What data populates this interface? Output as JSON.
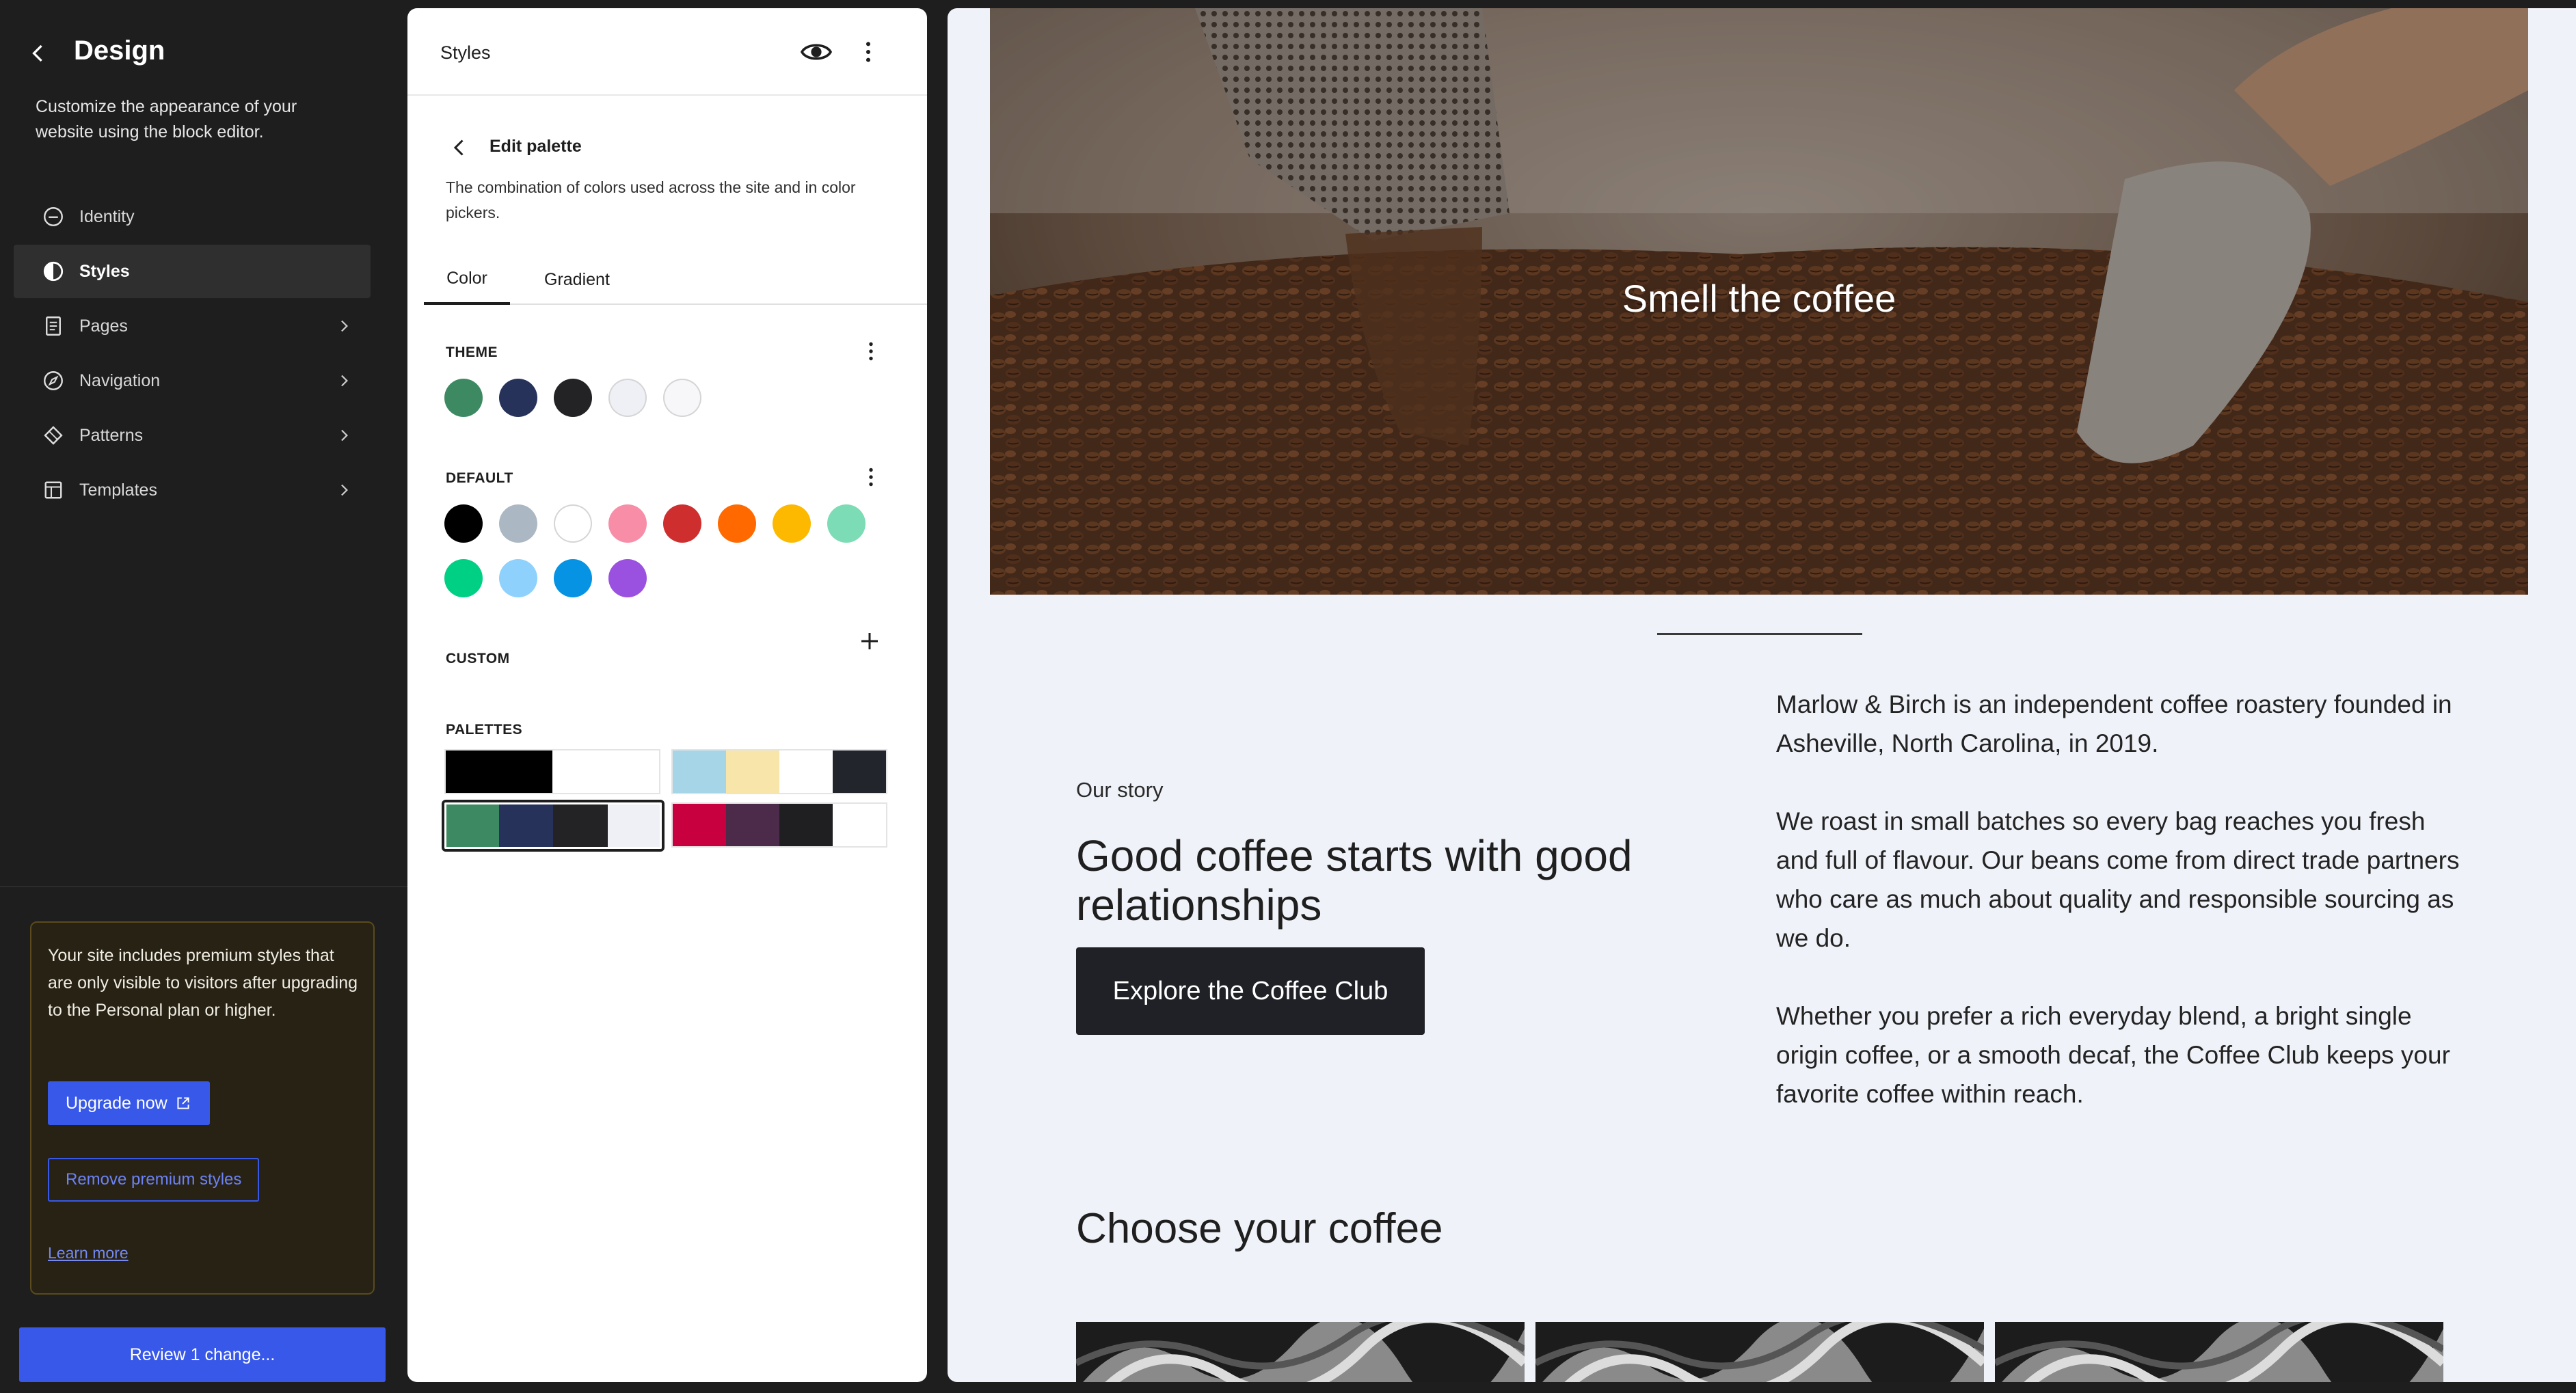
{
  "sidebar": {
    "title": "Design",
    "description": "Customize the appearance of your website using the block editor.",
    "nav": [
      {
        "label": "Identity",
        "icon": "identity-icon",
        "has_chevron": false,
        "active": false
      },
      {
        "label": "Styles",
        "icon": "styles-icon",
        "has_chevron": false,
        "active": true
      },
      {
        "label": "Pages",
        "icon": "page-icon",
        "has_chevron": true,
        "active": false
      },
      {
        "label": "Navigation",
        "icon": "navigation-icon",
        "has_chevron": true,
        "active": false
      },
      {
        "label": "Patterns",
        "icon": "patterns-icon",
        "has_chevron": true,
        "active": false
      },
      {
        "label": "Templates",
        "icon": "templates-icon",
        "has_chevron": true,
        "active": false
      }
    ],
    "premium_notice": {
      "text": "Your site includes premium styles that are only visible to visitors after upgrading to the Personal plan or higher.",
      "upgrade_label": "Upgrade now",
      "remove_label": "Remove premium styles",
      "learn_more_label": "Learn more"
    },
    "review_label": "Review 1 change..."
  },
  "styles_panel": {
    "title": "Styles",
    "edit_title": "Edit palette",
    "edit_description": "The combination of colors used across the site and in color pickers.",
    "tabs": [
      "Color",
      "Gradient"
    ],
    "active_tab": "Color",
    "theme_label": "THEME",
    "theme_colors": [
      "#3d8a62",
      "#27325a",
      "#232325",
      "#eff0f5",
      "#f7f7fa"
    ],
    "default_label": "DEFAULT",
    "default_colors": [
      "#000000",
      "#abb8c3",
      "#ffffff",
      "#f78da7",
      "#cf2e2e",
      "#ff6900",
      "#fcb900",
      "#7bdcb5",
      "#00d084",
      "#8ed1fc",
      "#0693e3",
      "#9b51e0"
    ],
    "custom_label": "CUSTOM",
    "palettes_label": "PALETTES",
    "palettes": [
      {
        "colors": [
          "#000000",
          "#000000",
          "#ffffff",
          "#ffffff"
        ],
        "selected": false
      },
      {
        "colors": [
          "#a7d5e8",
          "#f8e5a9",
          "#ffffff",
          "#22252b"
        ],
        "selected": false
      },
      {
        "colors": [
          "#3d8a62",
          "#27325a",
          "#232325",
          "#eff0f5"
        ],
        "selected": true
      },
      {
        "colors": [
          "#c9003f",
          "#4c2b4a",
          "#1f1f22",
          "#ffffff"
        ],
        "selected": false
      }
    ]
  },
  "preview": {
    "hero_title": "Smell the coffee",
    "story_kicker": "Our story",
    "story_heading": "Good coffee starts with good relationships",
    "cta_label": "Explore the Coffee Club",
    "story_paragraphs": [
      "Marlow & Birch is an independent coffee roastery founded in Asheville, North Carolina, in 2019.",
      "We roast in small batches so every bag reaches you fresh and full of flavour. Our beans come from direct trade partners who care as much about quality and responsible sourcing as we do.",
      "Whether you prefer a rich everyday blend, a bright single origin coffee, or a smooth decaf, the Coffee Club keeps your favorite coffee within reach."
    ],
    "choose_title": "Choose your coffee"
  }
}
